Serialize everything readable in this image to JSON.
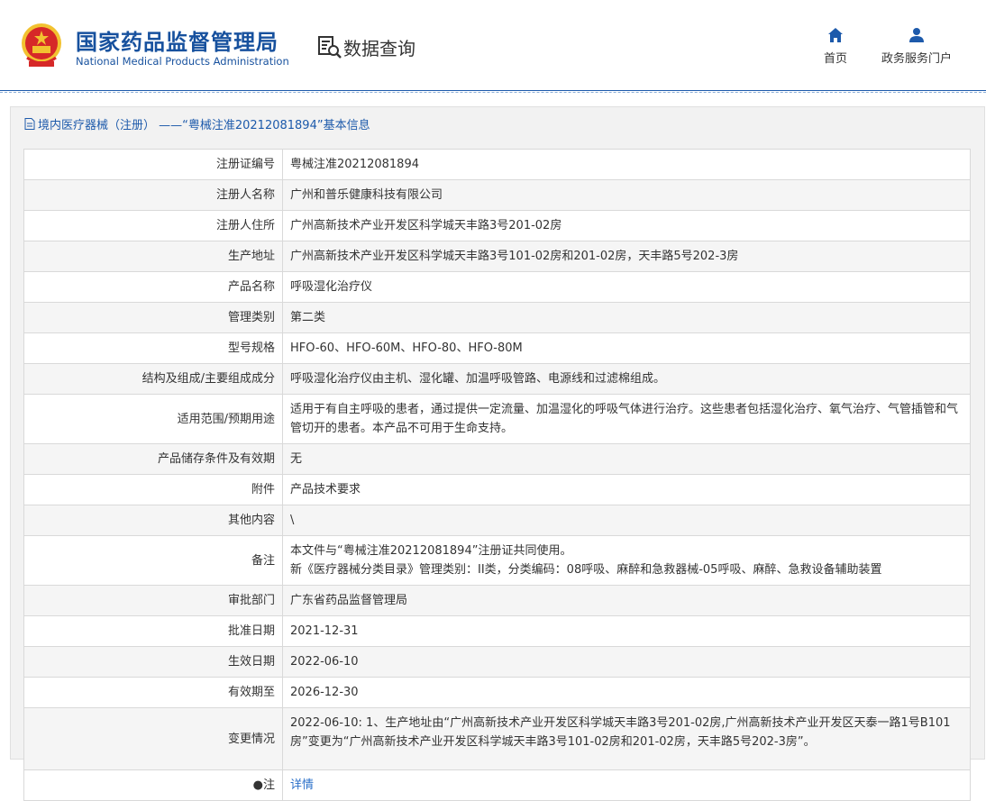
{
  "header": {
    "org_name_cn": "国家药品监督管理局",
    "org_name_en": "National Medical Products Administration",
    "section_title": "数据查询",
    "nav": [
      {
        "label": "首页",
        "icon": "home-icon"
      },
      {
        "label": "政务服务门户",
        "icon": "user-icon"
      }
    ]
  },
  "panel": {
    "title": "境内医疗器械（注册） ——“粤械注准20212081894”基本信息"
  },
  "rows": [
    {
      "label": "注册证编号",
      "value": "粤械注准20212081894"
    },
    {
      "label": "注册人名称",
      "value": "广州和普乐健康科技有限公司"
    },
    {
      "label": "注册人住所",
      "value": "广州高新技术产业开发区科学城天丰路3号201-02房"
    },
    {
      "label": "生产地址",
      "value": "广州高新技术产业开发区科学城天丰路3号101-02房和201-02房，天丰路5号202-3房"
    },
    {
      "label": "产品名称",
      "value": "呼吸湿化治疗仪"
    },
    {
      "label": "管理类别",
      "value": "第二类"
    },
    {
      "label": "型号规格",
      "value": "HFO-60、HFO-60M、HFO-80、HFO-80M"
    },
    {
      "label": "结构及组成/主要组成成分",
      "value": "呼吸湿化治疗仪由主机、湿化罐、加温呼吸管路、电源线和过滤棉组成。"
    },
    {
      "label": "适用范围/预期用途",
      "value": "适用于有自主呼吸的患者，通过提供一定流量、加温湿化的呼吸气体进行治疗。这些患者包括湿化治疗、氧气治疗、气管插管和气管切开的患者。本产品不可用于生命支持。"
    },
    {
      "label": "产品储存条件及有效期",
      "value": "无"
    },
    {
      "label": "附件",
      "value": "产品技术要求"
    },
    {
      "label": "其他内容",
      "value": "\\"
    },
    {
      "label": "备注",
      "value_lines": [
        "本文件与“粤械注准20212081894”注册证共同使用。",
        "新《医疗器械分类目录》管理类别：II类，分类编码：08呼吸、麻醉和急救器械-05呼吸、麻醉、急救设备辅助装置"
      ]
    },
    {
      "label": "审批部门",
      "value": "广东省药品监督管理局"
    },
    {
      "label": "批准日期",
      "value": "2021-12-31"
    },
    {
      "label": "生效日期",
      "value": "2022-06-10"
    },
    {
      "label": "有效期至",
      "value": "2026-12-30"
    },
    {
      "label": "变更情况",
      "value": "2022-06-10: 1、生产地址由“广州高新技术产业开发区科学城天丰路3号201-02房,广州高新技术产业开发区天泰一路1号B101房”变更为“广州高新技术产业开发区科学城天丰路3号101-02房和201-02房，天丰路5号202-3房”。"
    },
    {
      "label": "注",
      "value": "详情"
    }
  ],
  "colors": {
    "brand": "#17519e",
    "link": "#2a6fc9",
    "emblem_red": "#d62828",
    "emblem_gold": "#f2c230"
  }
}
